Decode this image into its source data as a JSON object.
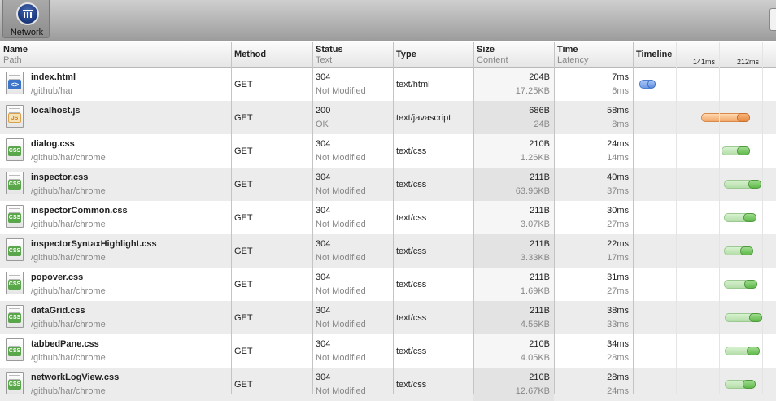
{
  "toolbar": {
    "network_label": "Network"
  },
  "columns": {
    "name": {
      "title": "Name",
      "sub": "Path"
    },
    "method": {
      "title": "Method"
    },
    "status": {
      "title": "Status",
      "sub": "Text"
    },
    "type": {
      "title": "Type"
    },
    "size": {
      "title": "Size",
      "sub": "Content"
    },
    "time": {
      "title": "Time",
      "sub": "Latency"
    },
    "timeline": {
      "title": "Timeline"
    }
  },
  "timeline_ticks": [
    "141ms",
    "212ms"
  ],
  "rows": [
    {
      "name": "index.html",
      "path": "/github/har",
      "method": "GET",
      "status": "304",
      "status_text": "Not Modified",
      "type": "text/html",
      "size": "204B",
      "content": "17.25KB",
      "time": "7ms",
      "latency": "6ms",
      "icon": "html"
    },
    {
      "name": "localhost.js",
      "path": "",
      "method": "GET",
      "status": "200",
      "status_text": "OK",
      "type": "text/javascript",
      "size": "686B",
      "content": "24B",
      "time": "58ms",
      "latency": "8ms",
      "icon": "js"
    },
    {
      "name": "dialog.css",
      "path": "/github/har/chrome",
      "method": "GET",
      "status": "304",
      "status_text": "Not Modified",
      "type": "text/css",
      "size": "210B",
      "content": "1.26KB",
      "time": "24ms",
      "latency": "14ms",
      "icon": "css"
    },
    {
      "name": "inspector.css",
      "path": "/github/har/chrome",
      "method": "GET",
      "status": "304",
      "status_text": "Not Modified",
      "type": "text/css",
      "size": "211B",
      "content": "63.96KB",
      "time": "40ms",
      "latency": "37ms",
      "icon": "css"
    },
    {
      "name": "inspectorCommon.css",
      "path": "/github/har/chrome",
      "method": "GET",
      "status": "304",
      "status_text": "Not Modified",
      "type": "text/css",
      "size": "211B",
      "content": "3.07KB",
      "time": "30ms",
      "latency": "27ms",
      "icon": "css"
    },
    {
      "name": "inspectorSyntaxHighlight.css",
      "path": "/github/har/chrome",
      "method": "GET",
      "status": "304",
      "status_text": "Not Modified",
      "type": "text/css",
      "size": "211B",
      "content": "3.33KB",
      "time": "22ms",
      "latency": "17ms",
      "icon": "css"
    },
    {
      "name": "popover.css",
      "path": "/github/har/chrome",
      "method": "GET",
      "status": "304",
      "status_text": "Not Modified",
      "type": "text/css",
      "size": "211B",
      "content": "1.69KB",
      "time": "31ms",
      "latency": "27ms",
      "icon": "css"
    },
    {
      "name": "dataGrid.css",
      "path": "/github/har/chrome",
      "method": "GET",
      "status": "304",
      "status_text": "Not Modified",
      "type": "text/css",
      "size": "211B",
      "content": "4.56KB",
      "time": "38ms",
      "latency": "33ms",
      "icon": "css"
    },
    {
      "name": "tabbedPane.css",
      "path": "/github/har/chrome",
      "method": "GET",
      "status": "304",
      "status_text": "Not Modified",
      "type": "text/css",
      "size": "210B",
      "content": "4.05KB",
      "time": "34ms",
      "latency": "28ms",
      "icon": "css"
    },
    {
      "name": "networkLogView.css",
      "path": "/github/har/chrome",
      "method": "GET",
      "status": "304",
      "status_text": "Not Modified",
      "type": "text/css",
      "size": "210B",
      "content": "12.67KB",
      "time": "28ms",
      "latency": "24ms",
      "icon": "css"
    }
  ],
  "timeline_colors": {
    "css": "#6fc35a",
    "js": "#ee9a55",
    "html": "#6f9be6"
  }
}
